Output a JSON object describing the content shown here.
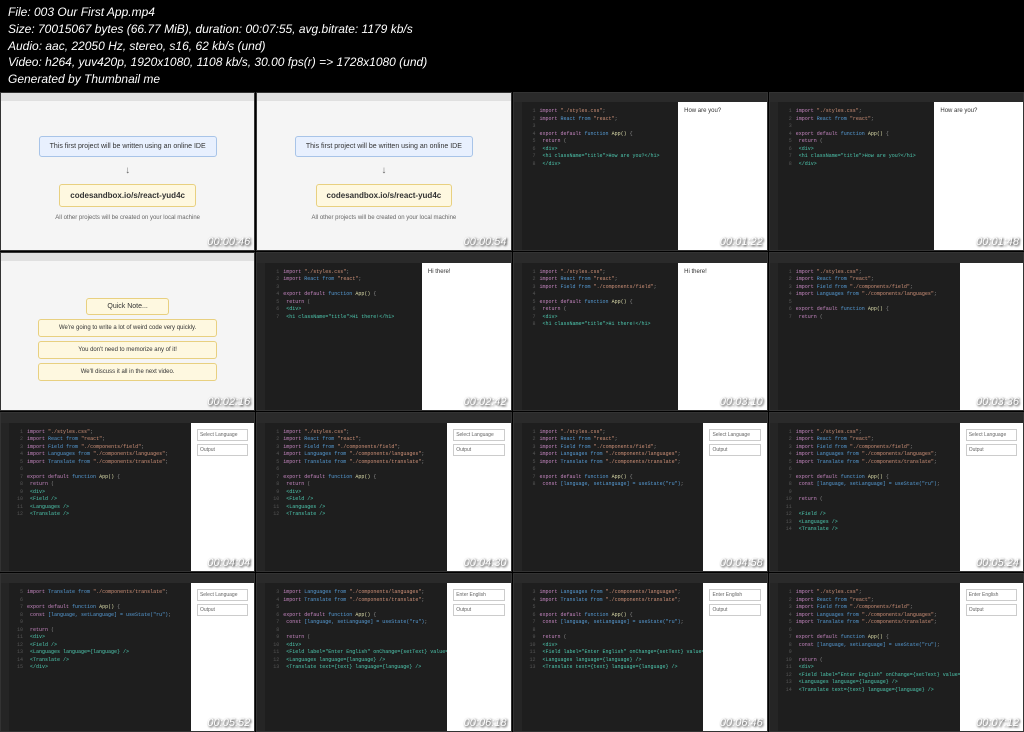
{
  "header": {
    "file": "File: 003 Our First App.mp4",
    "size": "Size: 70015067 bytes (66.77 MiB), duration: 00:07:55, avg.bitrate: 1179 kb/s",
    "audio": "Audio: aac, 22050 Hz, stereo, s16, 62 kb/s (und)",
    "video": "Video: h264, yuv420p, 1920x1080, 1108 kb/s, 30.00 fps(r) => 1728x1080 (und)",
    "generated": "Generated by Thumbnail me"
  },
  "timestamps": [
    "00:00:46",
    "00:00:54",
    "00:01:22",
    "00:01:48",
    "00:02:16",
    "00:02:42",
    "00:03:10",
    "00:03:36",
    "00:04:04",
    "00:04:30",
    "00:04:58",
    "00:05:24",
    "00:05:52",
    "00:06:18",
    "00:06:46",
    "00:07:12"
  ],
  "slide1": {
    "title": "This first project will be written using an online IDE",
    "url": "codesandbox.io/s/react-yud4c",
    "note": "All other projects will be created on your local machine"
  },
  "slide5": {
    "title": "Quick Note...",
    "line1": "We're going to write a lot of weird code very quickly.",
    "line2": "You don't need to memorize any of it!",
    "line3": "We'll discuss it all in the next video."
  },
  "preview": {
    "howAreYou": "How are you?",
    "hiThere": "Hi there!",
    "selectLang": "Select Language",
    "output": "Output",
    "enterEnglish": "Enter English"
  },
  "code": {
    "import1": "import",
    "stylesPath": "\"./styles.css\"",
    "reactFrom": "React from",
    "reactPath": "\"react\"",
    "fieldFrom": "Field from",
    "fieldPath": "\"./components/field\"",
    "langFrom": "Languages from",
    "langPath": "\"./components/languages\"",
    "transFrom": "Translate from",
    "transPath": "\"./components/translate\"",
    "exportDefault": "export default",
    "function": "function",
    "app": "App()",
    "return": "return",
    "const": "const",
    "useState": "[language, setLanguage] = useState(\"ru\")",
    "divOpen": "<div>",
    "divClose": "</div>",
    "h1": "<h1 className=\"title\">Hi there!</h1>",
    "h1How": "<h1 className=\"title\">How are you?</h1>",
    "field": "<Field />",
    "fieldLabel": "<Field label=\"Enter English\" onChange={setText} value={text} />",
    "languages": "<Languages />",
    "langProps": "<Languages language={language} />",
    "translate": "<Translate />",
    "translateProps": "<Translate text={text} language={language} />"
  }
}
